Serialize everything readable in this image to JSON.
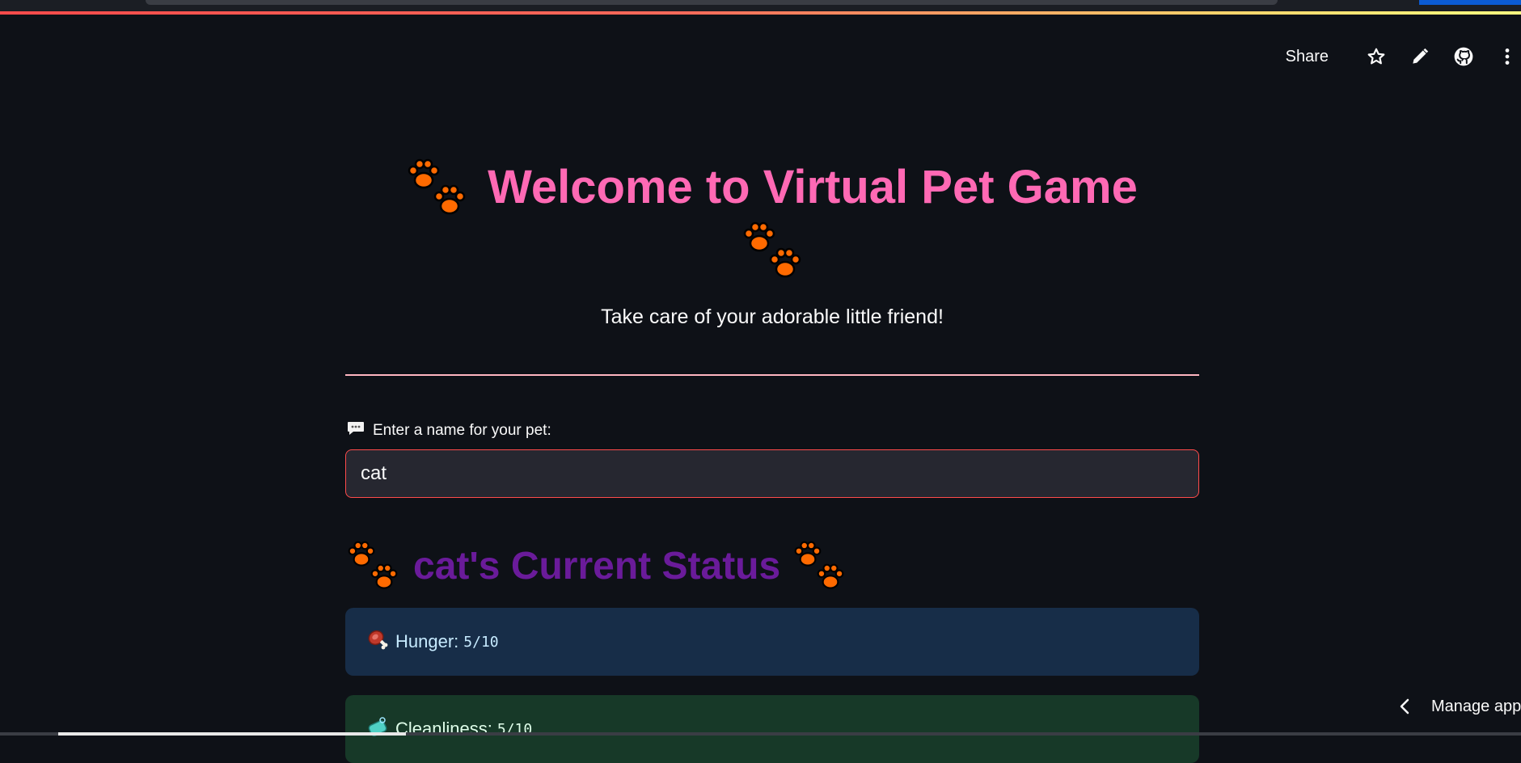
{
  "toolbar": {
    "share_label": "Share",
    "icons": [
      "star-icon",
      "pencil-icon",
      "github-icon",
      "more-vert-icon"
    ]
  },
  "header": {
    "title": "Welcome to Virtual Pet Game",
    "subtitle": "Take care of your adorable little friend!"
  },
  "name_input": {
    "label": "Enter a name for your pet:",
    "value": "cat"
  },
  "status": {
    "title": "cat's Current Status",
    "cards": [
      {
        "icon": "meat-icon",
        "label": "Hunger:",
        "value": "5/10",
        "bg": "#172d48"
      },
      {
        "icon": "soap-icon",
        "label": "Cleanliness:",
        "value": "5/10",
        "bg": "#173928"
      }
    ]
  },
  "footer": {
    "manage_label": "Manage app"
  },
  "colors": {
    "background": "#0e1117",
    "title": "#ff69b4",
    "status_title": "#6a1b9a",
    "divider": "#ffb6c1",
    "input_border": "#ff4b4b",
    "paw": "#ff6a00"
  }
}
